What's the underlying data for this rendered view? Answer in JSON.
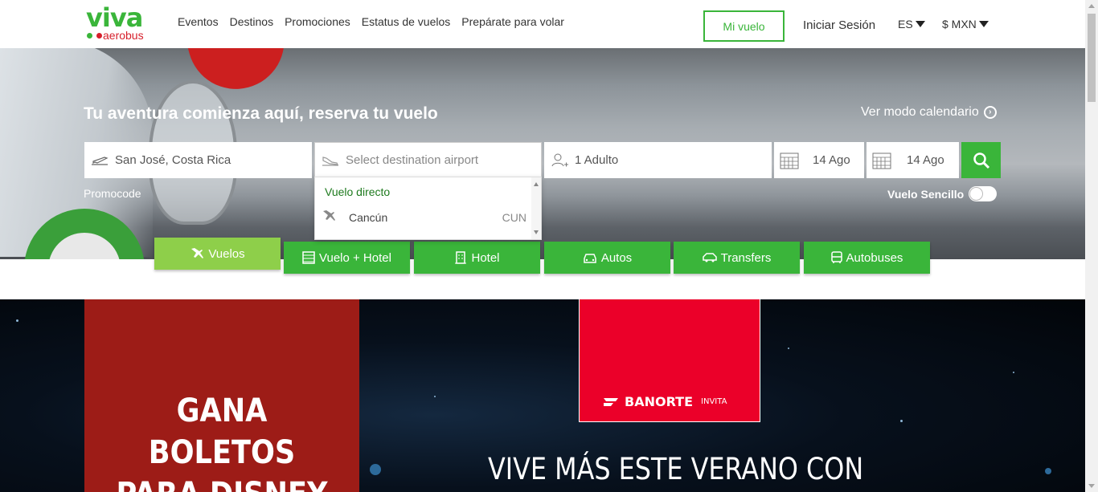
{
  "brand": {
    "logo_main": "viva",
    "logo_sub": "aerobus",
    "green": "#3ab53a",
    "red": "#d61f2b"
  },
  "nav": {
    "items": [
      "Eventos",
      "Destinos",
      "Promociones",
      "Estatus de vuelos",
      "Prepárate para volar"
    ],
    "my_flight": "Mi vuelo",
    "login": "Iniciar Sesión",
    "language": "ES",
    "currency": "$ MXN"
  },
  "hero": {
    "title": "Tu aventura comienza aquí, reserva tu vuelo",
    "calendar_link": "Ver modo calendario",
    "origin": "San José, Costa Rica",
    "destination_placeholder": "Select destination airport",
    "passengers": "1 Adulto",
    "date_departure": "14 Ago",
    "date_return": "14 Ago",
    "promocode": "Promocode",
    "one_way_label": "Vuelo Sencillo",
    "one_way_on": false
  },
  "dropdown": {
    "header": "Vuelo directo",
    "items": [
      {
        "city": "Cancún",
        "code": "CUN",
        "icon": "plane-icon"
      }
    ]
  },
  "tabs": [
    {
      "label": "Vuelos",
      "icon": "plane-icon",
      "active": true
    },
    {
      "label": "Vuelo + Hotel",
      "icon": "building-icon",
      "active": false
    },
    {
      "label": "Hotel",
      "icon": "hotel-icon",
      "active": false
    },
    {
      "label": "Autos",
      "icon": "car-icon",
      "active": false
    },
    {
      "label": "Transfers",
      "icon": "shuttle-icon",
      "active": false
    },
    {
      "label": "Autobuses",
      "icon": "bus-icon",
      "active": false
    }
  ],
  "banner": {
    "left_text_1": "GANA",
    "left_text_2": "BOLETOS",
    "left_text_3": "PARA DISNEY",
    "sponsor": "BANORTE",
    "sponsor_sub": "INVITA",
    "headline": "VIVE MÁS ESTE VERANO CON"
  }
}
